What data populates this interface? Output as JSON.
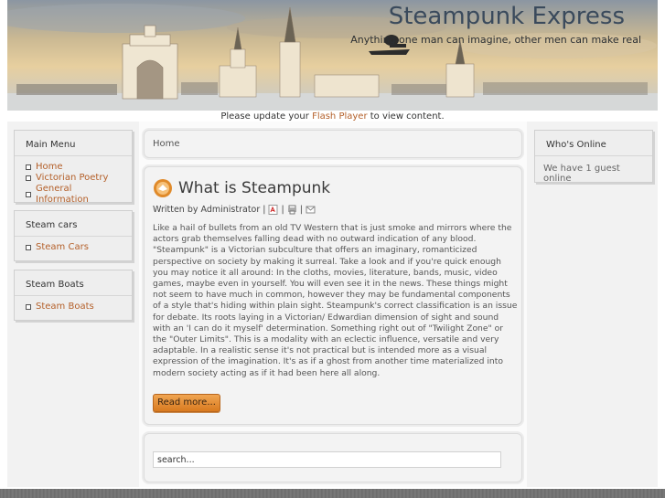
{
  "header": {
    "site_title": "Steampunk Express",
    "tagline": "Anything one man can imagine, other men can make real"
  },
  "flash": {
    "before": "Please update your ",
    "link": "Flash Player",
    "after": " to view content."
  },
  "main_menu": {
    "title": "Main Menu",
    "items": [
      {
        "label": "Home"
      },
      {
        "label": "Victorian Poetry"
      },
      {
        "label": "General Information"
      }
    ]
  },
  "steam_cars": {
    "title": "Steam cars",
    "items": [
      {
        "label": "Steam Cars"
      }
    ]
  },
  "steam_boats": {
    "title": "Steam Boats",
    "items": [
      {
        "label": "Steam Boats"
      }
    ]
  },
  "breadcrumb": "Home",
  "article": {
    "title": "What is Steampunk",
    "byline": "Written by Administrator",
    "body": "Like a hail of bullets from an old TV Western that is just smoke and mirrors where the actors grab themselves falling dead with no outward indication of any blood.  \"Steampunk\" is a Victorian subculture that offers an imaginary, romanticized perspective on society by making it surreal. Take a look and if you're quick enough you may notice it all around: In the cloths, movies, literature, bands, music, video games, maybe even in yourself. You will even see it in the news. These things might not seem to have much in common, however they may be fundamental components of a style that's hiding within plain sight. Steampunk's correct classification is an issue for debate. Its roots laying in a Victorian/ Edwardian dimension of sight and sound with an 'I can do it myself' determination. Something right out of \"Twilight Zone\" or the \"Outer Limits\". This is a modality with an eclectic influence, versatile and very adaptable. In a realistic sense it's not practical but is intended more as a visual expression of the imagination. It's as if a ghost from another time materialized into modern society acting as if it had been here all along.",
    "read_more": "Read more..."
  },
  "search": {
    "value": "search..."
  },
  "whos_online": {
    "title": "Who's Online",
    "text": "We have 1 guest online"
  },
  "colors": {
    "link": "#b4602a",
    "button": "#e48a2f",
    "title": "#3a4a5c"
  }
}
